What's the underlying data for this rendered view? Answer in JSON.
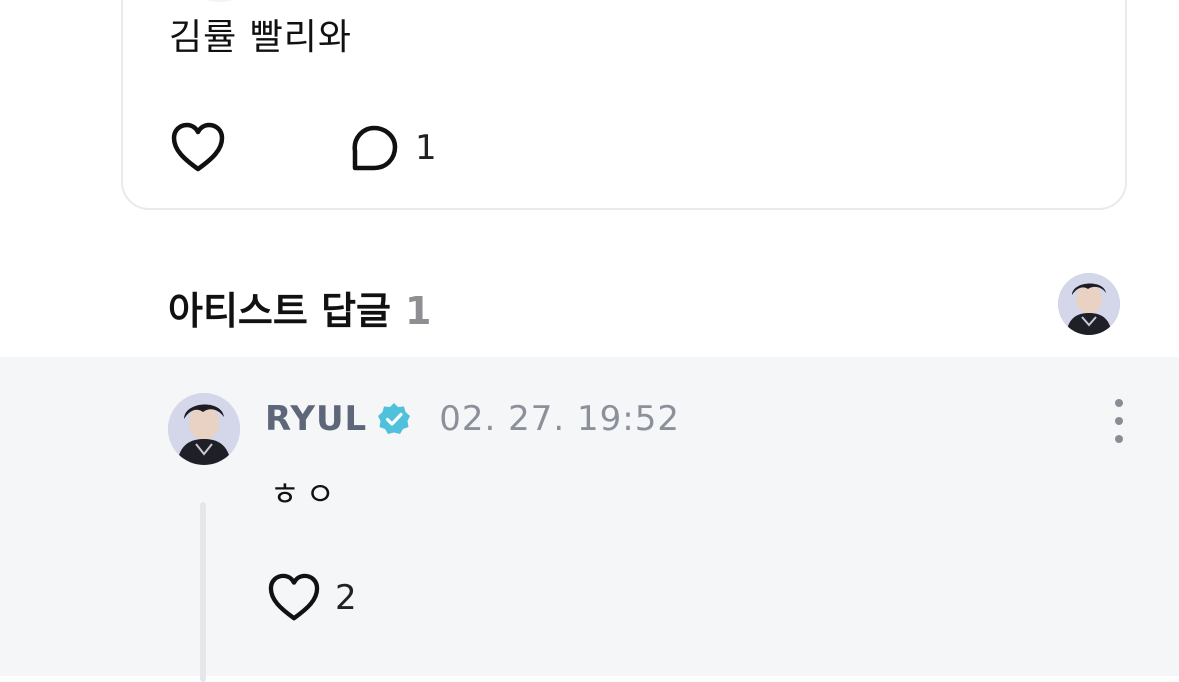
{
  "post": {
    "text": "김률 빨리와",
    "comment_count": "1"
  },
  "artist_replies": {
    "title": "아티스트 답글",
    "count": "1"
  },
  "reply": {
    "author": "RYUL",
    "timestamp": "02. 27. 19:52",
    "text": "ㅎㅇ",
    "like_count": "2"
  },
  "icons": {
    "like": "heart-outline-icon",
    "comment": "speech-bubble-icon",
    "verified": "verified-badge-icon",
    "more": "vertical-ellipsis-icon"
  },
  "colors": {
    "verified": "#4fc1da",
    "author_name": "#5e6679",
    "reply_background": "#f5f6f8",
    "count_gray": "#8e8e93"
  }
}
